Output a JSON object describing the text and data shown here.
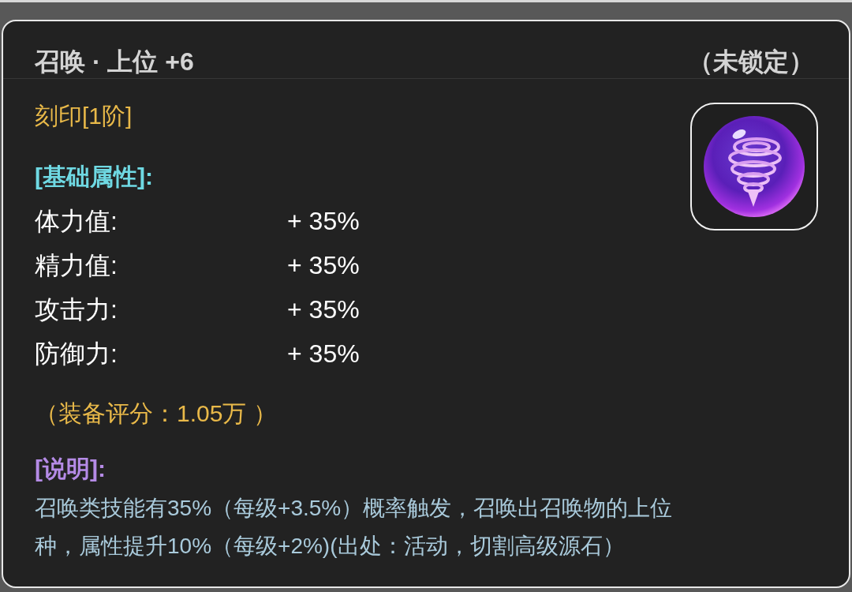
{
  "header": {
    "title": "召唤 · 上位 +6",
    "lock_status": "（未锁定）"
  },
  "grade": "刻印[1阶]",
  "base_attributes": {
    "heading": "[基础属性]:",
    "rows": [
      {
        "label": "体力值:",
        "value": "+ 35%"
      },
      {
        "label": "精力值:",
        "value": "+ 35%"
      },
      {
        "label": "攻击力:",
        "value": "+ 35%"
      },
      {
        "label": "防御力:",
        "value": "+ 35%"
      }
    ]
  },
  "score": "（装备评分：1.05万 ）",
  "description": {
    "heading": "[说明]:",
    "text": "召唤类技能有35%（每级+3.5%）概率触发，召唤出召唤物的上位种，属性提升10%（每级+2%)(出处：活动，切割高级源石）"
  }
}
